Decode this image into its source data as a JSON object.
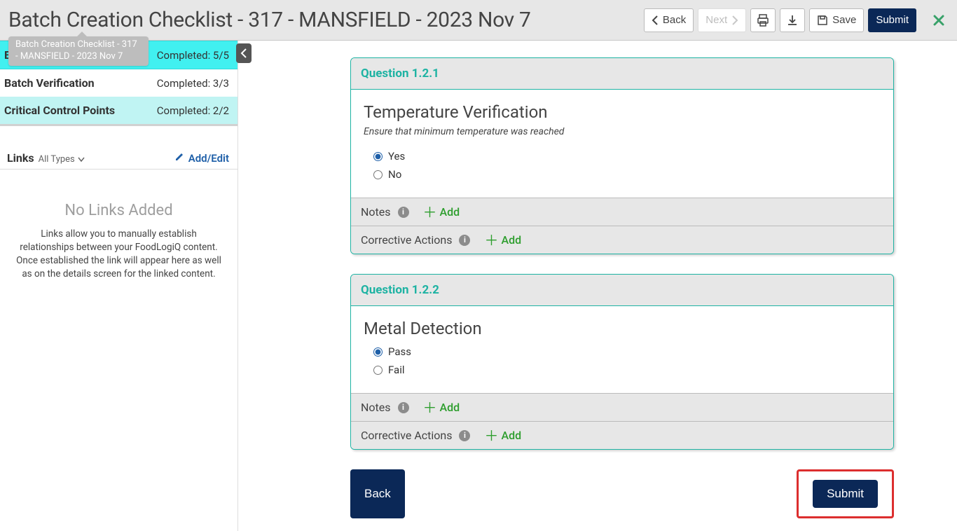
{
  "header": {
    "title": "Batch Creation Checklist - 317 - MANSFIELD - 2023 Nov 7",
    "back": "Back",
    "next": "Next",
    "save": "Save",
    "submit": "Submit"
  },
  "crumb_tooltip": "Batch Creation Checklist - 317 - MANSFIELD - 2023 Nov 7",
  "sidebar": {
    "sections": [
      {
        "name": "Batch Checklist",
        "status": "Completed: 5/5",
        "state": "active"
      },
      {
        "name": "Batch Verification",
        "status": "Completed: 3/3",
        "state": ""
      },
      {
        "name": "Critical Control Points",
        "status": "Completed: 2/2",
        "state": "current"
      }
    ],
    "links": {
      "label": "Links",
      "filter": "All Types",
      "add_edit": "Add/Edit",
      "empty_title": "No Links Added",
      "empty_body": "Links allow you to manually establish relationships between your FoodLogiQ content. Once established the link will appear here as well as on the details screen for the linked content."
    }
  },
  "questions": [
    {
      "num": "Question 1.2.1",
      "title": "Temperature Verification",
      "note": "Ensure that minimum temperature was reached",
      "options": [
        "Yes",
        "No"
      ],
      "selected": 0,
      "notes_label": "Notes",
      "ca_label": "Corrective Actions",
      "add_label": "Add"
    },
    {
      "num": "Question 1.2.2",
      "title": "Metal Detection",
      "note": "",
      "options": [
        "Pass",
        "Fail"
      ],
      "selected": 0,
      "notes_label": "Notes",
      "ca_label": "Corrective Actions",
      "add_label": "Add"
    }
  ],
  "nav": {
    "back": "Back",
    "submit": "Submit"
  }
}
